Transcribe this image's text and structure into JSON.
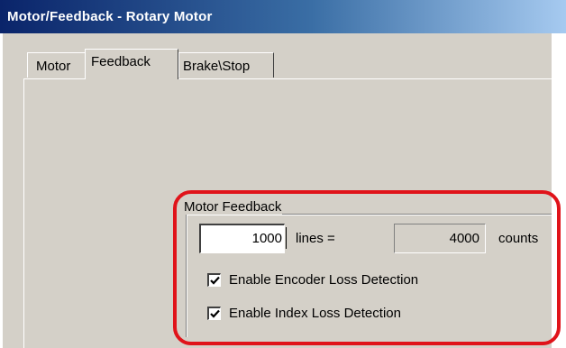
{
  "window": {
    "title": "Motor/Feedback - Rotary Motor"
  },
  "tabs": [
    {
      "label": "Motor"
    },
    {
      "label": "Feedback"
    },
    {
      "label": "Brake\\Stop"
    }
  ],
  "active_tab": "Feedback",
  "motor_feedback": {
    "group_title": "Motor Feedback",
    "lines_value": "1000",
    "lines_label": "lines  =",
    "counts_value": "4000",
    "counts_label": "counts",
    "checkboxes": [
      {
        "label": "Enable Encoder Loss Detection",
        "checked": true
      },
      {
        "label": "Enable Index Loss Detection",
        "checked": true
      }
    ]
  },
  "colors": {
    "highlight": "#e0131a",
    "title_bar": "#0a246a",
    "face": "#d4d0c8"
  }
}
